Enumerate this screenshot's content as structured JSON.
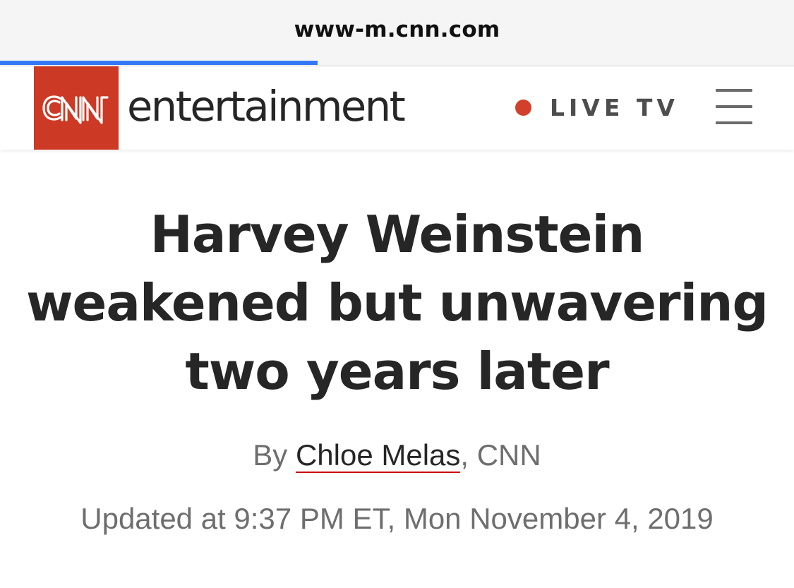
{
  "browser": {
    "url": "www-m.cnn.com",
    "load_progress": 0.4,
    "progress_color": "#3478f6"
  },
  "header": {
    "logo_text": "CNN",
    "logo_color": "#cc3a25",
    "section": "entertainment",
    "live_label": "LIVE TV",
    "live_dot_color": "#d2402b",
    "menu_icon": "hamburger-menu-icon"
  },
  "article": {
    "headline_lines": [
      "Harvey Weinstein",
      "weakened but unwavering",
      "two years later"
    ],
    "byline_prefix": "By ",
    "author": "Chloe Melas",
    "byline_suffix": ", CNN",
    "updated": "Updated at 9:37 PM ET, Mon November 4, 2019"
  }
}
